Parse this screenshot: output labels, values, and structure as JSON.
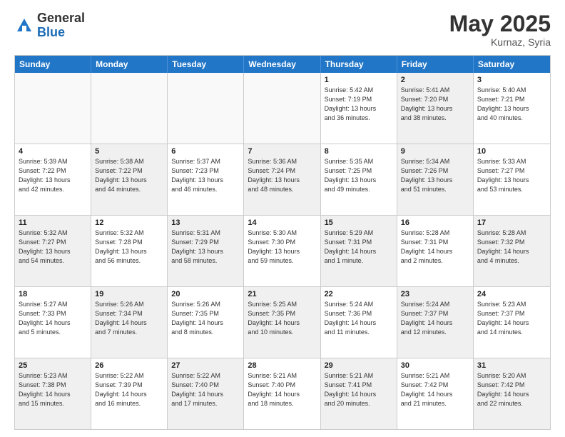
{
  "header": {
    "logo_general": "General",
    "logo_blue": "Blue",
    "month_year": "May 2025",
    "location": "Kurnaz, Syria"
  },
  "days_of_week": [
    "Sunday",
    "Monday",
    "Tuesday",
    "Wednesday",
    "Thursday",
    "Friday",
    "Saturday"
  ],
  "weeks": [
    [
      {
        "day": "",
        "text": "",
        "empty": true
      },
      {
        "day": "",
        "text": "",
        "empty": true
      },
      {
        "day": "",
        "text": "",
        "empty": true
      },
      {
        "day": "",
        "text": "",
        "empty": true
      },
      {
        "day": "1",
        "text": "Sunrise: 5:42 AM\nSunset: 7:19 PM\nDaylight: 13 hours\nand 36 minutes."
      },
      {
        "day": "2",
        "text": "Sunrise: 5:41 AM\nSunset: 7:20 PM\nDaylight: 13 hours\nand 38 minutes.",
        "shaded": true
      },
      {
        "day": "3",
        "text": "Sunrise: 5:40 AM\nSunset: 7:21 PM\nDaylight: 13 hours\nand 40 minutes."
      }
    ],
    [
      {
        "day": "4",
        "text": "Sunrise: 5:39 AM\nSunset: 7:22 PM\nDaylight: 13 hours\nand 42 minutes."
      },
      {
        "day": "5",
        "text": "Sunrise: 5:38 AM\nSunset: 7:22 PM\nDaylight: 13 hours\nand 44 minutes.",
        "shaded": true
      },
      {
        "day": "6",
        "text": "Sunrise: 5:37 AM\nSunset: 7:23 PM\nDaylight: 13 hours\nand 46 minutes."
      },
      {
        "day": "7",
        "text": "Sunrise: 5:36 AM\nSunset: 7:24 PM\nDaylight: 13 hours\nand 48 minutes.",
        "shaded": true
      },
      {
        "day": "8",
        "text": "Sunrise: 5:35 AM\nSunset: 7:25 PM\nDaylight: 13 hours\nand 49 minutes."
      },
      {
        "day": "9",
        "text": "Sunrise: 5:34 AM\nSunset: 7:26 PM\nDaylight: 13 hours\nand 51 minutes.",
        "shaded": true
      },
      {
        "day": "10",
        "text": "Sunrise: 5:33 AM\nSunset: 7:27 PM\nDaylight: 13 hours\nand 53 minutes."
      }
    ],
    [
      {
        "day": "11",
        "text": "Sunrise: 5:32 AM\nSunset: 7:27 PM\nDaylight: 13 hours\nand 54 minutes.",
        "shaded": true
      },
      {
        "day": "12",
        "text": "Sunrise: 5:32 AM\nSunset: 7:28 PM\nDaylight: 13 hours\nand 56 minutes."
      },
      {
        "day": "13",
        "text": "Sunrise: 5:31 AM\nSunset: 7:29 PM\nDaylight: 13 hours\nand 58 minutes.",
        "shaded": true
      },
      {
        "day": "14",
        "text": "Sunrise: 5:30 AM\nSunset: 7:30 PM\nDaylight: 13 hours\nand 59 minutes."
      },
      {
        "day": "15",
        "text": "Sunrise: 5:29 AM\nSunset: 7:31 PM\nDaylight: 14 hours\nand 1 minute.",
        "shaded": true
      },
      {
        "day": "16",
        "text": "Sunrise: 5:28 AM\nSunset: 7:31 PM\nDaylight: 14 hours\nand 2 minutes."
      },
      {
        "day": "17",
        "text": "Sunrise: 5:28 AM\nSunset: 7:32 PM\nDaylight: 14 hours\nand 4 minutes.",
        "shaded": true
      }
    ],
    [
      {
        "day": "18",
        "text": "Sunrise: 5:27 AM\nSunset: 7:33 PM\nDaylight: 14 hours\nand 5 minutes."
      },
      {
        "day": "19",
        "text": "Sunrise: 5:26 AM\nSunset: 7:34 PM\nDaylight: 14 hours\nand 7 minutes.",
        "shaded": true
      },
      {
        "day": "20",
        "text": "Sunrise: 5:26 AM\nSunset: 7:35 PM\nDaylight: 14 hours\nand 8 minutes."
      },
      {
        "day": "21",
        "text": "Sunrise: 5:25 AM\nSunset: 7:35 PM\nDaylight: 14 hours\nand 10 minutes.",
        "shaded": true
      },
      {
        "day": "22",
        "text": "Sunrise: 5:24 AM\nSunset: 7:36 PM\nDaylight: 14 hours\nand 11 minutes."
      },
      {
        "day": "23",
        "text": "Sunrise: 5:24 AM\nSunset: 7:37 PM\nDaylight: 14 hours\nand 12 minutes.",
        "shaded": true
      },
      {
        "day": "24",
        "text": "Sunrise: 5:23 AM\nSunset: 7:37 PM\nDaylight: 14 hours\nand 14 minutes."
      }
    ],
    [
      {
        "day": "25",
        "text": "Sunrise: 5:23 AM\nSunset: 7:38 PM\nDaylight: 14 hours\nand 15 minutes.",
        "shaded": true
      },
      {
        "day": "26",
        "text": "Sunrise: 5:22 AM\nSunset: 7:39 PM\nDaylight: 14 hours\nand 16 minutes."
      },
      {
        "day": "27",
        "text": "Sunrise: 5:22 AM\nSunset: 7:40 PM\nDaylight: 14 hours\nand 17 minutes.",
        "shaded": true
      },
      {
        "day": "28",
        "text": "Sunrise: 5:21 AM\nSunset: 7:40 PM\nDaylight: 14 hours\nand 18 minutes."
      },
      {
        "day": "29",
        "text": "Sunrise: 5:21 AM\nSunset: 7:41 PM\nDaylight: 14 hours\nand 20 minutes.",
        "shaded": true
      },
      {
        "day": "30",
        "text": "Sunrise: 5:21 AM\nSunset: 7:42 PM\nDaylight: 14 hours\nand 21 minutes."
      },
      {
        "day": "31",
        "text": "Sunrise: 5:20 AM\nSunset: 7:42 PM\nDaylight: 14 hours\nand 22 minutes.",
        "shaded": true
      }
    ]
  ]
}
